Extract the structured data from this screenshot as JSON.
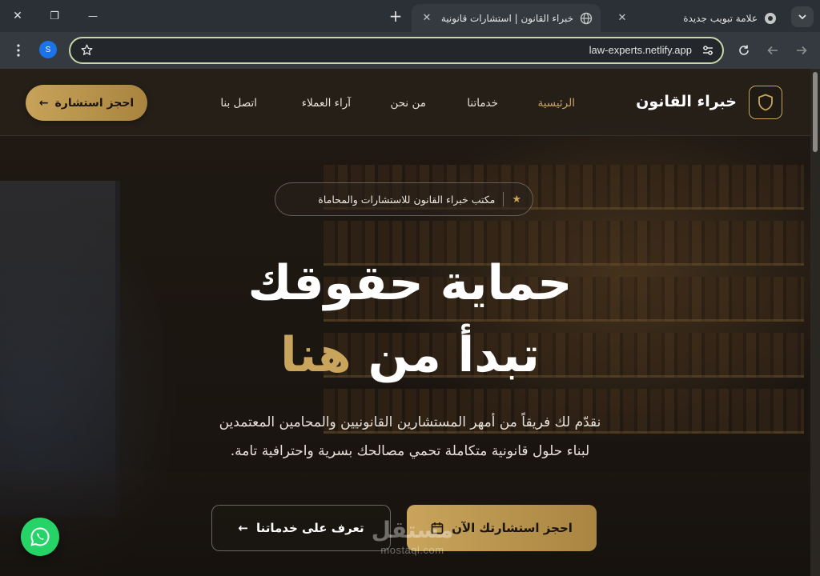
{
  "browser": {
    "tabs": [
      {
        "title": "خبراء القانون | استشارات قانونية م...",
        "active": true
      },
      {
        "title": "علامة تبويب جديدة",
        "active": false
      }
    ],
    "url": "law-experts.netlify.app",
    "profile_initial": "S",
    "new_tab_symbol": "+",
    "close_symbol": "✕",
    "minimize_symbol": "—",
    "restore_symbol": "❐"
  },
  "nav": {
    "logo_text": "خبراء القانون",
    "links": [
      {
        "label": "الرئيسية",
        "active": true
      },
      {
        "label": "خدماتنا",
        "active": false
      },
      {
        "label": "من نحن",
        "active": false
      },
      {
        "label": "آراء العملاء",
        "active": false
      },
      {
        "label": "اتصل بنا",
        "active": false
      }
    ],
    "cta_label": "احجز استشارة",
    "arrow": "←"
  },
  "hero": {
    "badge_text": "مكتب خبراء القانون للاستشارات والمحاماة",
    "badge_star": "★",
    "title_line1": "حماية حقوقك",
    "title_line2_white": "تبدأ من",
    "title_line2_gold": "هنا",
    "description_line1": "نقدّم لك فريقاً من أمهر المستشارين القانونيين والمحامين المعتمدين",
    "description_line2": "لبناء حلول قانونية متكاملة تحمي مصالحك بسرية واحترافية تامة.",
    "primary_cta": "احجز استشارتك الآن",
    "secondary_cta": "تعرف على خدماتنا",
    "arrow": "←"
  },
  "watermark": {
    "arabic": "مستقل",
    "latin": "mostaql.com"
  },
  "colors": {
    "gold": "#c9a45c",
    "omnibox_border": "#c9d6a6",
    "whatsapp": "#25d366"
  },
  "icons": [
    "shield-icon",
    "star-icon",
    "calendar-icon",
    "whatsapp-icon",
    "arrow-left-icon",
    "globe-icon",
    "chrome-icon",
    "bookmark-star-icon",
    "site-settings-icon",
    "reload-icon",
    "back-icon",
    "forward-icon",
    "menu-dots-icon"
  ]
}
